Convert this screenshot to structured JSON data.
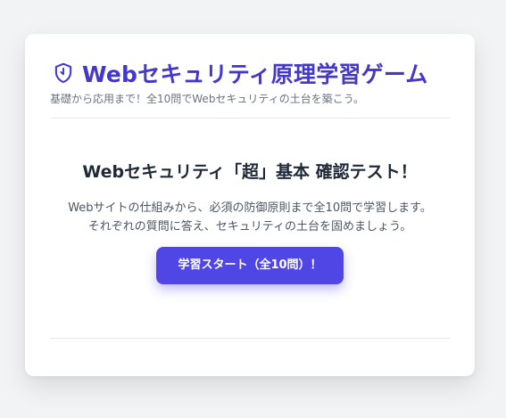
{
  "header": {
    "title": "Webセキュリティ原理学習ゲーム",
    "subtitle": "基礎から応用まで！全10問でWebセキュリティの土台を築こう。",
    "icon": "shield-icon"
  },
  "main": {
    "quiz_title": "Webセキュリティ「超」基本 確認テスト！",
    "description_line1": "Webサイトの仕組みから、必須の防御原則まで全10問で学習します。",
    "description_line2": "それぞれの質問に答え、セキュリティの土台を固めましょう。",
    "start_button_label": "学習スタート（全10問）！"
  },
  "colors": {
    "accent": "#4338ca",
    "button": "#4f46e5",
    "background": "#f2f3f5"
  }
}
